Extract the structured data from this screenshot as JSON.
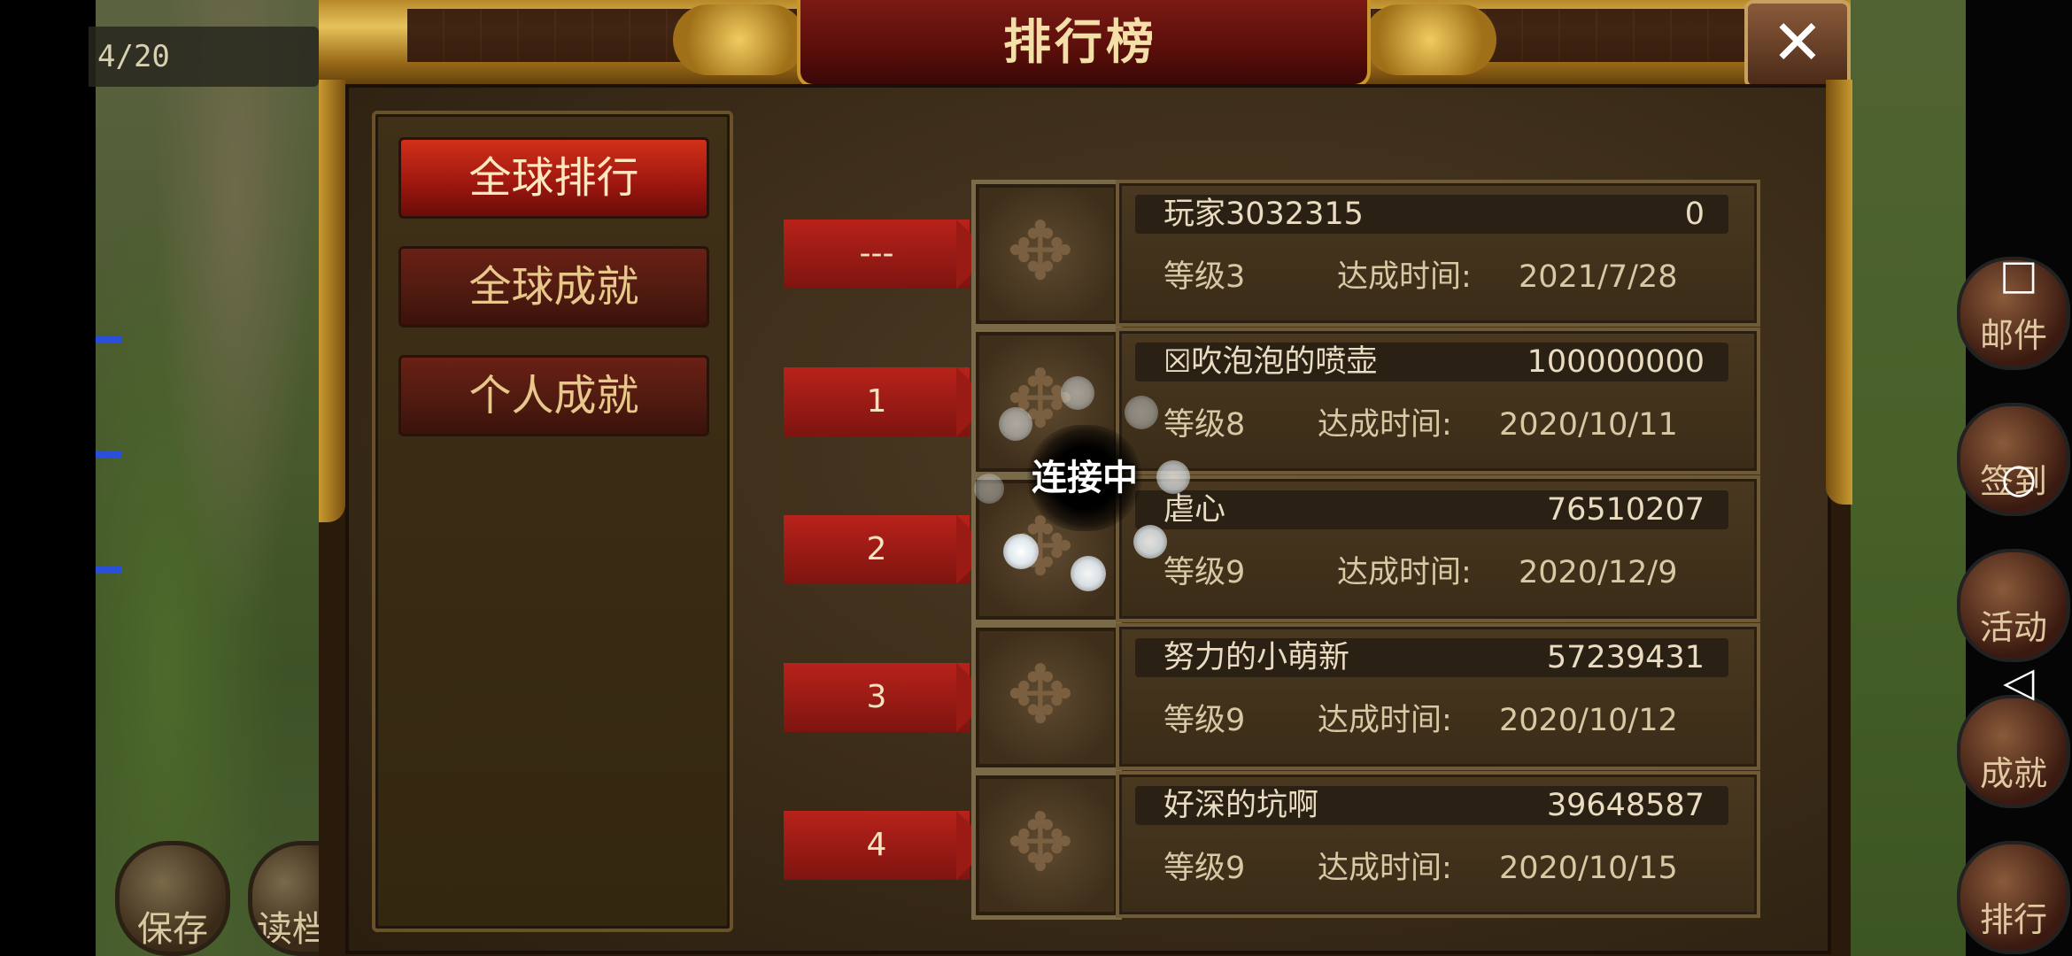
{
  "hud": {
    "counter": "4/20"
  },
  "title": "排行榜",
  "close_icon": "✕",
  "tabs": [
    {
      "label": "全球排行",
      "active": true
    },
    {
      "label": "全球成就",
      "active": false
    },
    {
      "label": "个人成就",
      "active": false
    }
  ],
  "rows": [
    {
      "rank": "---",
      "name": "玩家3032315",
      "score": "0",
      "level": "等级3",
      "time_label": "达成时间:",
      "date": "2021/7/28"
    },
    {
      "rank": "1",
      "name": "☒吹泡泡的喷壶",
      "score": "100000000",
      "level": "等级8",
      "time_label": "达成时间:",
      "date": "2020/10/11"
    },
    {
      "rank": "2",
      "name": "虐心",
      "score": "76510207",
      "level": "等级9",
      "time_label": "达成时间:",
      "date": "2020/12/9"
    },
    {
      "rank": "3",
      "name": "努力的小萌新",
      "score": "57239431",
      "level": "等级9",
      "time_label": "达成时间:",
      "date": "2020/10/12"
    },
    {
      "rank": "4",
      "name": "好深的坑啊",
      "score": "39648587",
      "level": "等级9",
      "time_label": "达成时间:",
      "date": "2020/10/15"
    }
  ],
  "loading": {
    "text": "连接中"
  },
  "side_buttons": {
    "save": "保存",
    "load": "读档",
    "mail": "邮件",
    "sign": "签到",
    "event": "活动",
    "achievement": "成就",
    "ranking": "排行"
  },
  "nav": {
    "recent": "□",
    "home": "○",
    "back": "◁"
  },
  "colors": {
    "accent_red": "#a01810",
    "gold": "#c8962c",
    "text_light": "#eadcc0"
  }
}
